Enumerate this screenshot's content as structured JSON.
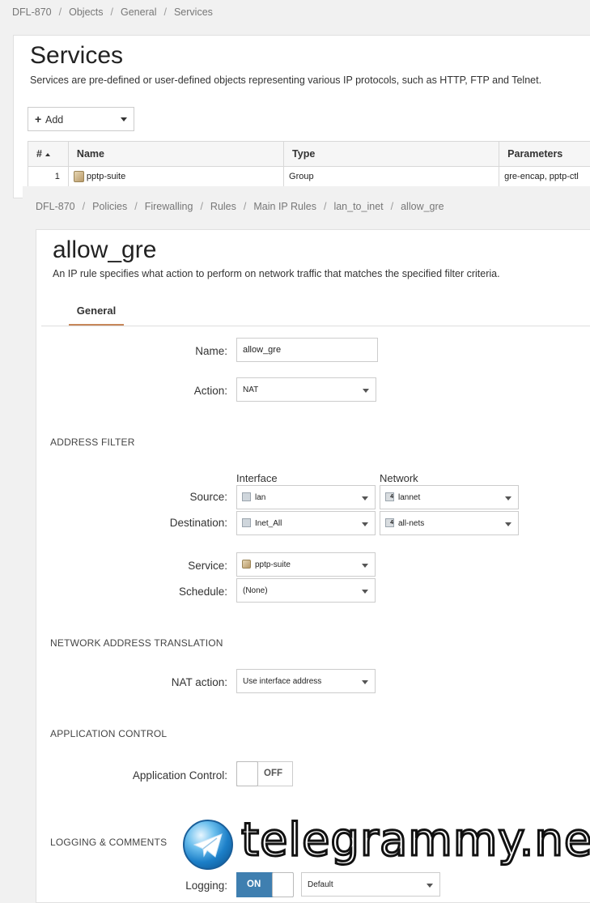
{
  "services_page": {
    "breadcrumb": [
      "DFL-870",
      "Objects",
      "General",
      "Services"
    ],
    "title": "Services",
    "description": "Services are pre-defined or user-defined objects representing various IP protocols, such as HTTP, FTP and Telnet.",
    "add_button": "Add",
    "table": {
      "columns": [
        "#",
        "Name",
        "Type",
        "Parameters"
      ],
      "rows": [
        {
          "num": "1",
          "name": "pptp-suite",
          "type": "Group",
          "params": "gre-encap, pptp-ctl"
        }
      ]
    }
  },
  "rule_page": {
    "breadcrumb": [
      "DFL-870",
      "Policies",
      "Firewalling",
      "Rules",
      "Main IP Rules",
      "lan_to_inet",
      "allow_gre"
    ],
    "title": "allow_gre",
    "description": "An IP rule specifies what action to perform on network traffic that matches the specified filter criteria.",
    "tab": "General",
    "name_label": "Name:",
    "name_value": "allow_gre",
    "action_label": "Action:",
    "action_value": "NAT",
    "address_filter": {
      "section": "ADDRESS FILTER",
      "interface_header": "Interface",
      "network_header": "Network",
      "source_label": "Source:",
      "source_interface": "lan",
      "source_network": "lannet",
      "destination_label": "Destination:",
      "destination_interface": "Inet_All",
      "destination_network": "all-nets",
      "net_icon_digit": "4"
    },
    "service_label": "Service:",
    "service_value": "pptp-suite",
    "schedule_label": "Schedule:",
    "schedule_value": "(None)",
    "nat": {
      "section": "NETWORK ADDRESS TRANSLATION",
      "action_label": "NAT action:",
      "action_value": "Use interface address"
    },
    "app_control": {
      "section": "APPLICATION CONTROL",
      "label": "Application Control:",
      "state": "OFF"
    },
    "logging": {
      "section": "LOGGING & COMMENTS",
      "label": "Logging:",
      "state": "ON",
      "value": "Default"
    }
  },
  "watermark": {
    "text": "telegrammy.net"
  },
  "colors": {
    "tab_underline": "#c7875a",
    "toggle_on": "#3f7fb0"
  }
}
